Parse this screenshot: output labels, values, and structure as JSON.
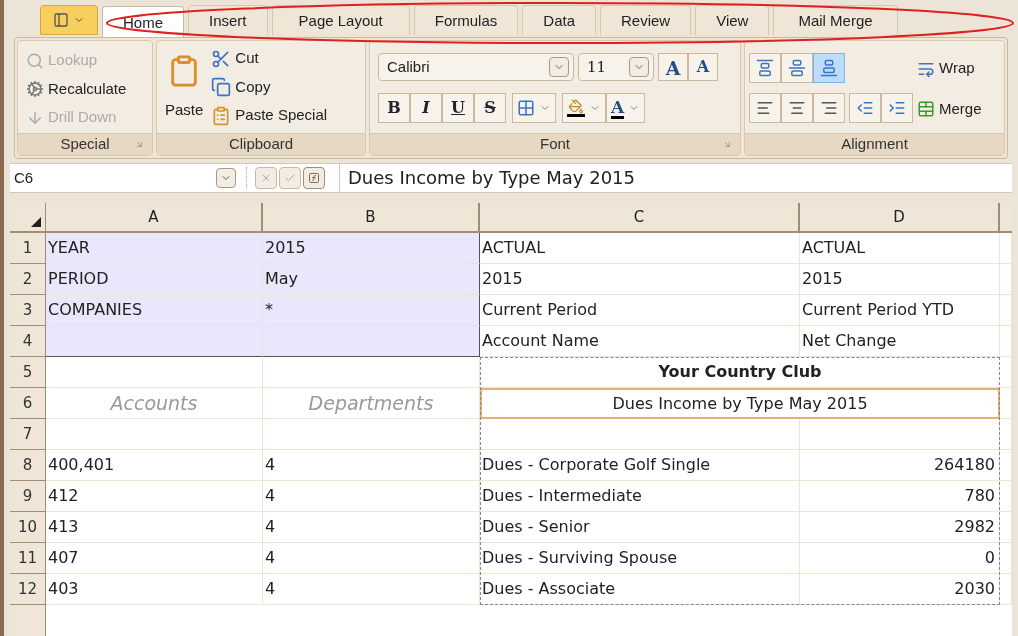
{
  "tabs": [
    {
      "label": "Home",
      "selected": true
    },
    {
      "label": "Insert",
      "selected": false
    },
    {
      "label": "Page Layout",
      "selected": false
    },
    {
      "label": "Formulas",
      "selected": false
    },
    {
      "label": "Data",
      "selected": false
    },
    {
      "label": "Review",
      "selected": false
    },
    {
      "label": "View",
      "selected": false
    },
    {
      "label": "Mail Merge",
      "selected": false
    }
  ],
  "ribbon": {
    "special": {
      "title": "Special",
      "items": [
        {
          "label": "Lookup",
          "disabled": true
        },
        {
          "label": "Recalculate",
          "disabled": false
        },
        {
          "label": "Drill Down",
          "disabled": true
        }
      ]
    },
    "clipboard": {
      "title": "Clipboard",
      "paste": "Paste",
      "items": [
        "Cut",
        "Copy",
        "Paste Special"
      ]
    },
    "font": {
      "title": "Font",
      "font_name": "Calibri",
      "font_size": "11",
      "size_buttons": [
        "A",
        "A"
      ],
      "format_buttons": [
        "B",
        "I",
        "U",
        "S"
      ],
      "font_color_button": "A"
    },
    "alignment": {
      "title": "Alignment",
      "vertical_buttons": [
        {
          "selected": false
        },
        {
          "selected": false
        },
        {
          "selected": true
        }
      ],
      "wrap": "Wrap",
      "merge": "Merge"
    }
  },
  "formula_bar": {
    "cell_ref": "C6",
    "value": "Dues Income by Type May 2015"
  },
  "sheet": {
    "columns": [
      "A",
      "B",
      "C",
      "D"
    ],
    "rows": [
      {
        "number": "1",
        "kind": "param",
        "a": "YEAR",
        "b": "2015",
        "c": "ACTUAL",
        "d": "ACTUAL"
      },
      {
        "number": "2",
        "kind": "param",
        "a": "PERIOD",
        "b": "May",
        "c": "2015",
        "d": "2015"
      },
      {
        "number": "3",
        "kind": "param",
        "a": "COMPANIES",
        "b": "*",
        "c": "Current Period",
        "d": "Current Period YTD"
      },
      {
        "number": "4",
        "kind": "param",
        "c": "Account Name",
        "d": "Net Change"
      },
      {
        "number": "5",
        "kind": "title",
        "title": "Your Country Club"
      },
      {
        "number": "6",
        "kind": "subtitle",
        "a": "Accounts",
        "b": "Departments",
        "title": "Dues Income by Type May 2015",
        "selected": true
      },
      {
        "number": "7",
        "kind": "blank"
      },
      {
        "number": "8",
        "kind": "data",
        "a": "400,401",
        "b": "4",
        "c": "Dues - Corporate Golf Single",
        "d": "264180"
      },
      {
        "number": "9",
        "kind": "data",
        "a": "412",
        "b": "4",
        "c": "Dues - Intermediate",
        "d": "780"
      },
      {
        "number": "10",
        "kind": "data",
        "a": "413",
        "b": "4",
        "c": "Dues - Senior",
        "d": "2982"
      },
      {
        "number": "11",
        "kind": "data",
        "a": "407",
        "b": "4",
        "c": "Dues - Surviving Spouse",
        "d": "0"
      },
      {
        "number": "12",
        "kind": "data",
        "a": "403",
        "b": "4",
        "c": "Dues - Associate",
        "d": "2030"
      }
    ]
  }
}
